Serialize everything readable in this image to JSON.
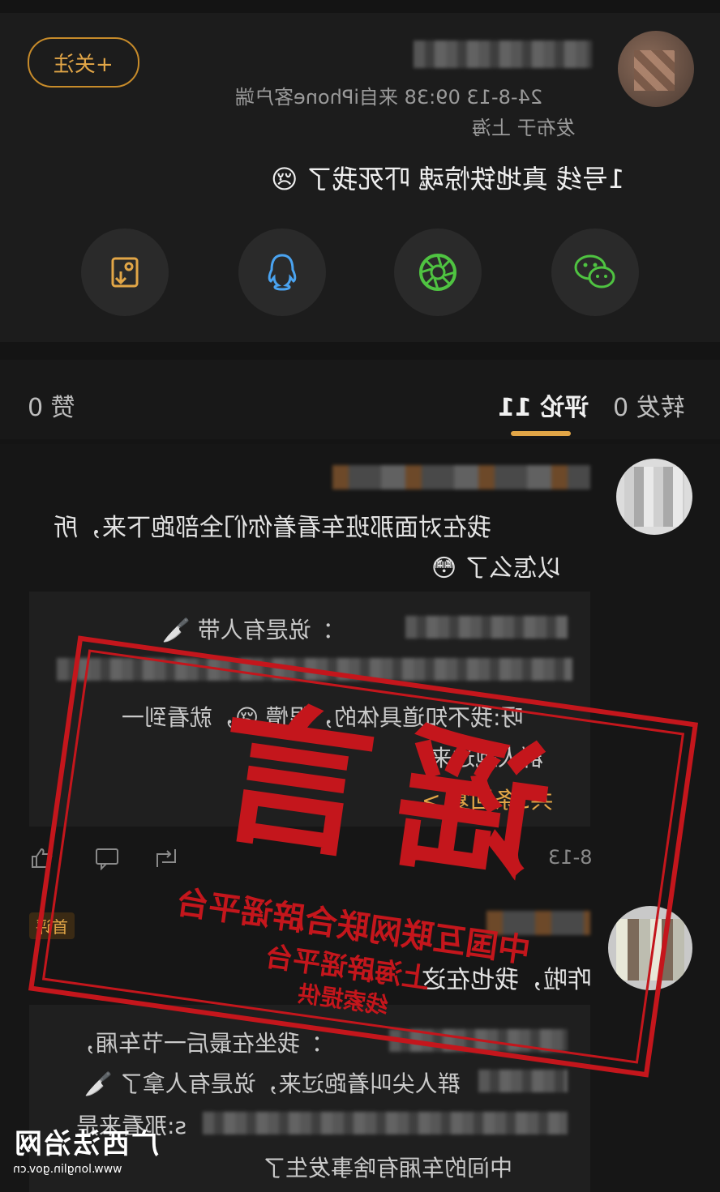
{
  "post": {
    "follow_label": "+关注",
    "meta_line": "24-8-13 09:38 来自iPhone客户端",
    "location": "发布于 上海",
    "text": "1号线 真地铁惊魂 吓死我了 😢"
  },
  "share": {
    "icons": [
      "save-image-icon",
      "qq-icon",
      "moments-icon",
      "wechat-icon"
    ]
  },
  "tabs": {
    "reposts": "转发 0",
    "comments": "评论 11",
    "likes": "赞 0"
  },
  "comment1": {
    "text_line1": "我在对面那班车看着你们全部跑下来，所",
    "text_line2": "以怎么了 😳",
    "reply1": "：说是有人带 🔪",
    "reply2_line1": "呀:我不知道具体的，很懵 😢，就看到一",
    "reply2_line2": "群人跑过来",
    "more": "共5条回复 >",
    "date": "8-13"
  },
  "comment2": {
    "badge": "首评",
    "text": "咋啦，我也在这",
    "reply1": "：我坐在最后一节车厢，",
    "reply2": "群人尖叫着跑过来，说是有人拿了 🔪",
    "reply3": "s:那看来是",
    "reply4": "中间的车厢有啥事发生了"
  },
  "stamp": {
    "main": "谣言",
    "line1": "中国互联网联合辟谣平台",
    "line2": "上海辟谣平台",
    "line3": "线索提供"
  },
  "watermark": {
    "logo_text": "广西法治网",
    "url": "www.longlin.gov.cn"
  },
  "colors": {
    "accent": "#e2a647",
    "stamp": "#c4161c",
    "background": "#141414"
  }
}
